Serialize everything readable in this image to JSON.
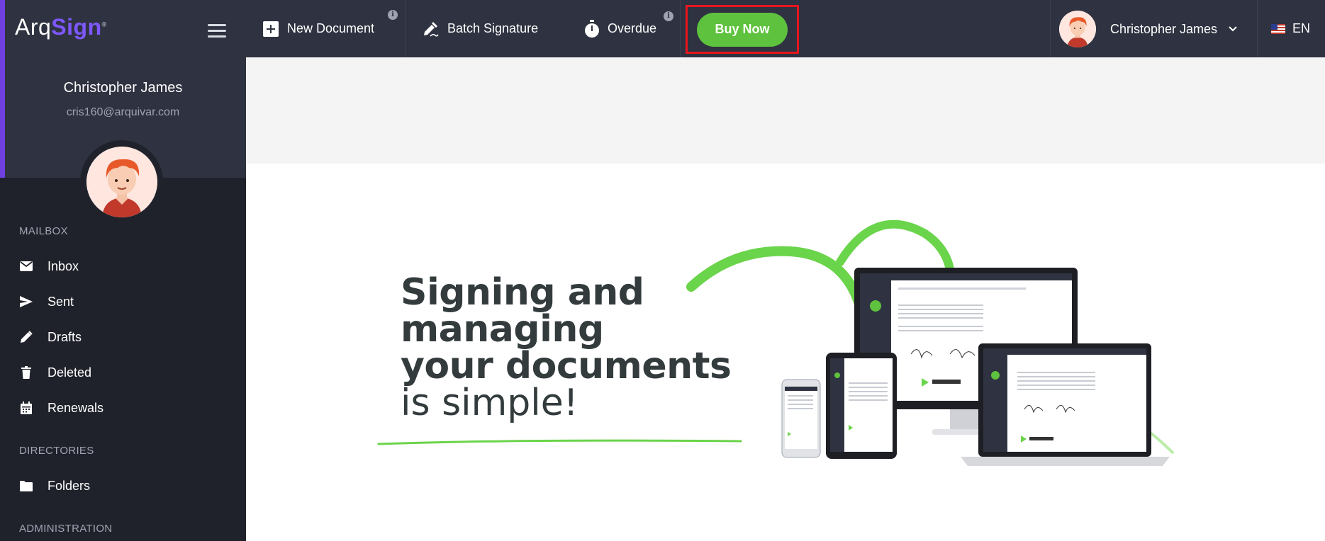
{
  "app": {
    "logo_prefix": "Arq",
    "logo_suffix": "Sign",
    "logo_tm": "®"
  },
  "profile": {
    "name": "Christopher James",
    "email": "cris160@arquivar.com"
  },
  "sidebar": {
    "sections": [
      {
        "title": "MAILBOX",
        "items": [
          {
            "label": "Inbox",
            "icon": "envelope-icon"
          },
          {
            "label": "Sent",
            "icon": "paper-plane-icon"
          },
          {
            "label": "Drafts",
            "icon": "pencil-icon"
          },
          {
            "label": "Deleted",
            "icon": "trash-icon"
          },
          {
            "label": "Renewals",
            "icon": "calendar-icon"
          }
        ]
      },
      {
        "title": "DIRECTORIES",
        "items": [
          {
            "label": "Folders",
            "icon": "folder-icon"
          }
        ]
      },
      {
        "title": "ADMINISTRATION",
        "items": []
      }
    ]
  },
  "topbar": {
    "new_document": "New Document",
    "batch_signature": "Batch Signature",
    "overdue": "Overdue",
    "buy_now": "Buy Now",
    "user_name": "Christopher James",
    "language": "EN"
  },
  "hero": {
    "line1": "Signing and",
    "line2": "managing",
    "line3": "your documents",
    "line4": "is simple!"
  },
  "colors": {
    "sidebar_bg": "#20222b",
    "topbar_bg": "#2f3240",
    "accent_purple": "#6f3fe0",
    "buy_green": "#5ec23e",
    "highlight_red": "#e8161d"
  }
}
